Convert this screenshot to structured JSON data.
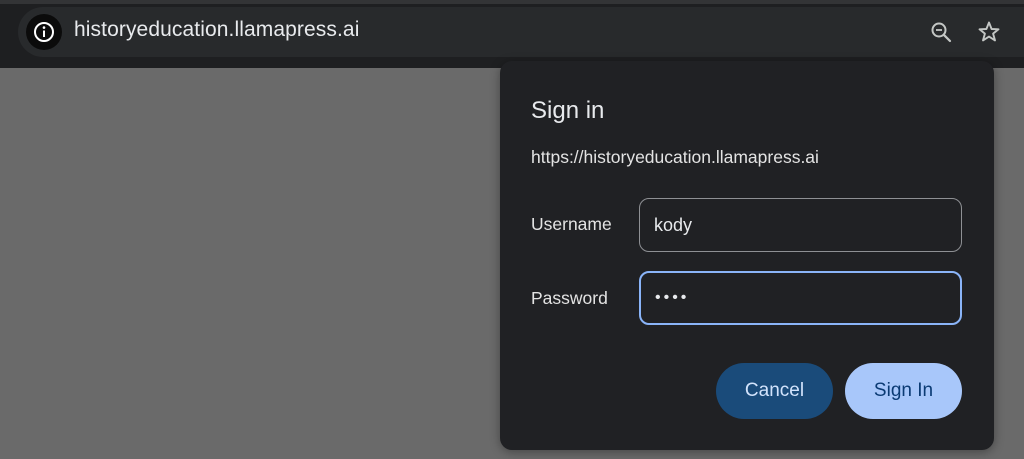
{
  "browser": {
    "url": "historyeducation.llamapress.ai",
    "icons": {
      "site_info": "info-icon",
      "zoom": "zoom-icon",
      "bookmark": "star-icon"
    }
  },
  "dialog": {
    "title": "Sign in",
    "origin": "https://historyeducation.llamapress.ai",
    "username_label": "Username",
    "username_value": "kody",
    "password_label": "Password",
    "password_value": "••••",
    "cancel_label": "Cancel",
    "signin_label": "Sign In"
  },
  "colors": {
    "page_background": "#6a6a6a",
    "dialog_background": "#202124",
    "focus_ring": "#8ab4f8",
    "cancel_button": "#1a4b7a",
    "signin_button": "#a8c7fa"
  }
}
